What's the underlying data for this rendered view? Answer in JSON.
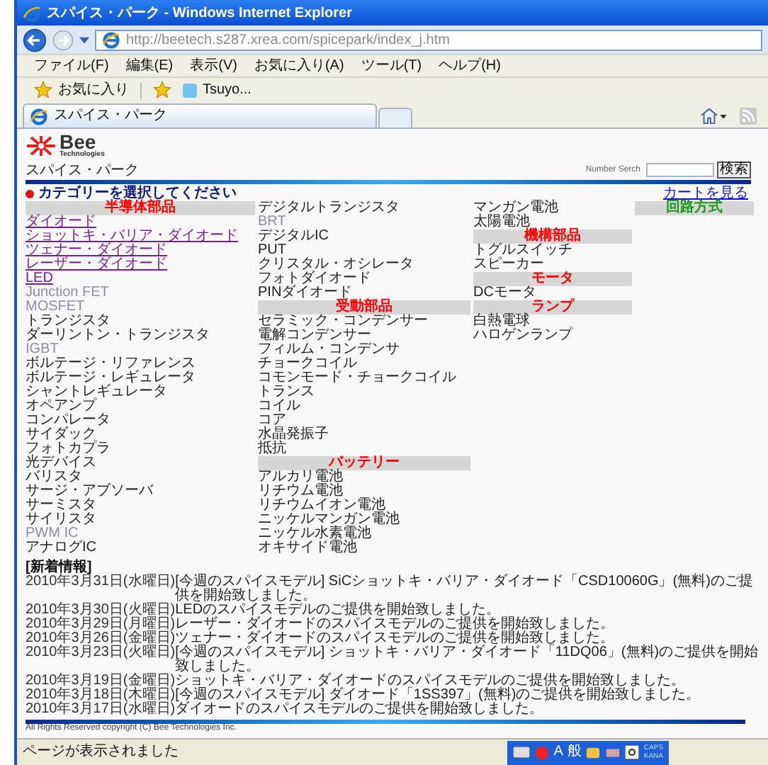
{
  "window": {
    "title": "スパイス・パーク - Windows Internet Explorer"
  },
  "address": {
    "value": "http://beetech.s287.xrea.com/spicepark/index_j.htm"
  },
  "menu": [
    "ファイル(F)",
    "編集(E)",
    "表示(V)",
    "お気に入り(A)",
    "ツール(T)",
    "ヘルプ(H)"
  ],
  "favorites_bar": {
    "label": "お気に入り",
    "link": "Tsuyo..."
  },
  "tabs": [
    {
      "label": "スパイス・パーク",
      "selected": true
    }
  ],
  "page": {
    "logo": {
      "name": "Bee",
      "subtitle": "Technologies"
    },
    "title": "スパイス・パーク",
    "search": {
      "label": "Number Serch",
      "button": "検索"
    },
    "prompt": "カテゴリーを選択してください",
    "cart_link": "カートを見る",
    "category_columns": [
      {
        "entries": [
          {
            "kind": "heading",
            "label": "半導体部品",
            "color": "#ff0000"
          },
          {
            "kind": "link",
            "label": "ダイオード"
          },
          {
            "kind": "link",
            "label": "ショットキ・バリア・ダイオード"
          },
          {
            "kind": "link",
            "label": "ツェナー・ダイオード"
          },
          {
            "kind": "link",
            "label": "レーザー・ダイオード"
          },
          {
            "kind": "link",
            "label": "LED"
          },
          {
            "kind": "muted",
            "label": "Junction FET"
          },
          {
            "kind": "muted",
            "label": "MOSFET"
          },
          {
            "kind": "plain",
            "label": "トランジスタ"
          },
          {
            "kind": "plain",
            "label": "ダーリントン・トランジスタ"
          },
          {
            "kind": "muted",
            "label": "IGBT"
          },
          {
            "kind": "plain",
            "label": "ボルテージ・リファレンス"
          },
          {
            "kind": "plain",
            "label": "ボルテージ・レギュレータ"
          },
          {
            "kind": "plain",
            "label": "シャントレギュレータ"
          },
          {
            "kind": "plain",
            "label": "オペアンプ"
          },
          {
            "kind": "plain",
            "label": "コンパレータ"
          },
          {
            "kind": "plain",
            "label": "サイダック"
          },
          {
            "kind": "plain",
            "label": "フォトカプラ"
          },
          {
            "kind": "plain",
            "label": "光デバイス"
          },
          {
            "kind": "plain",
            "label": "バリスタ"
          },
          {
            "kind": "plain",
            "label": "サージ・アブソーバ"
          },
          {
            "kind": "plain",
            "label": "サーミスタ"
          },
          {
            "kind": "plain",
            "label": "サイリスタ"
          },
          {
            "kind": "muted",
            "label": "PWM IC"
          },
          {
            "kind": "plain",
            "label": "アナログIC"
          }
        ]
      },
      {
        "entries": [
          {
            "kind": "plain",
            "label": "デジタルトランジスタ"
          },
          {
            "kind": "muted",
            "label": "BRT"
          },
          {
            "kind": "plain",
            "label": "デジタルIC"
          },
          {
            "kind": "plain",
            "label": "PUT"
          },
          {
            "kind": "plain",
            "label": "クリスタル・オシレータ"
          },
          {
            "kind": "plain",
            "label": "フォトダイオード"
          },
          {
            "kind": "plain",
            "label": "PINダイオード"
          },
          {
            "kind": "heading",
            "label": "受動部品",
            "color": "#ff0000"
          },
          {
            "kind": "plain",
            "label": "セラミック・コンデンサー"
          },
          {
            "kind": "plain",
            "label": "電解コンデンサー"
          },
          {
            "kind": "plain",
            "label": "フィルム・コンデンサ"
          },
          {
            "kind": "plain",
            "label": "チョークコイル"
          },
          {
            "kind": "plain",
            "label": "コモンモード・チョークコイル"
          },
          {
            "kind": "plain",
            "label": "トランス"
          },
          {
            "kind": "plain",
            "label": "コイル"
          },
          {
            "kind": "plain",
            "label": "コア"
          },
          {
            "kind": "plain",
            "label": "水晶発振子"
          },
          {
            "kind": "plain",
            "label": "抵抗"
          },
          {
            "kind": "heading",
            "label": "バッテリー",
            "color": "#ff0000"
          },
          {
            "kind": "plain",
            "label": "アルカリ電池"
          },
          {
            "kind": "plain",
            "label": "リチウム電池"
          },
          {
            "kind": "plain",
            "label": "リチウムイオン電池"
          },
          {
            "kind": "plain",
            "label": "ニッケルマンガン電池"
          },
          {
            "kind": "plain",
            "label": "ニッケル水素電池"
          },
          {
            "kind": "plain",
            "label": "オキサイド電池"
          }
        ]
      },
      {
        "entries": [
          {
            "kind": "plain",
            "label": "マンガン電池"
          },
          {
            "kind": "plain",
            "label": "太陽電池"
          },
          {
            "kind": "heading",
            "label": "機構部品",
            "color": "#ff0000"
          },
          {
            "kind": "plain",
            "label": "トグルスイッチ"
          },
          {
            "kind": "plain",
            "label": "スピーカー"
          },
          {
            "kind": "heading",
            "label": "モータ",
            "color": "#ff0000"
          },
          {
            "kind": "plain",
            "label": "DCモータ"
          },
          {
            "kind": "heading",
            "label": "ランプ",
            "color": "#ff0000"
          },
          {
            "kind": "plain",
            "label": "白熱電球"
          },
          {
            "kind": "plain",
            "label": "ハロゲンランプ"
          }
        ]
      },
      {
        "entries": [
          {
            "kind": "heading",
            "label": "回路方式",
            "color": "#1a9a1a"
          }
        ]
      }
    ],
    "news": {
      "heading": "[新着情報]",
      "items": [
        {
          "date": "2010年3月31日(水曜日)",
          "text": "[今週のスパイスモデル] SiCショットキ・バリア・ダイオード「CSD10060G」(無料)のご提供を開始致しました。"
        },
        {
          "date": "2010年3月30日(火曜日)",
          "text": "LEDのスパイスモデルのご提供を開始致しました。"
        },
        {
          "date": "2010年3月29日(月曜日)",
          "text": "レーザー・ダイオードのスパイスモデルのご提供を開始致しました。"
        },
        {
          "date": "2010年3月26日(金曜日)",
          "text": "ツェナー・ダイオードのスパイスモデルのご提供を開始致しました。"
        },
        {
          "date": "2010年3月23日(火曜日)",
          "text": "[今週のスパイスモデル] ショットキ・バリア・ダイオード「11DQ06」(無料)のご提供を開始致しました。"
        },
        {
          "date": "2010年3月19日(金曜日)",
          "text": "ショットキ・バリア・ダイオードのスパイスモデルのご提供を開始致しました。"
        },
        {
          "date": "2010年3月18日(木曜日)",
          "text": "[今週のスパイスモデル] ダイオード「1SS397」(無料)のご提供を開始致しました。"
        },
        {
          "date": "2010年3月17日(水曜日)",
          "text": "ダイオードのスパイスモデルのご提供を開始致しました。"
        }
      ]
    },
    "copyright": "All Rights Reserved copyright (C) Bee Technologies Inc."
  },
  "status_bar": {
    "text": "ページが表示されました",
    "ime": {
      "mode": "A",
      "dictionary": "般",
      "caps": "CAPS",
      "kana": "KANA"
    }
  }
}
